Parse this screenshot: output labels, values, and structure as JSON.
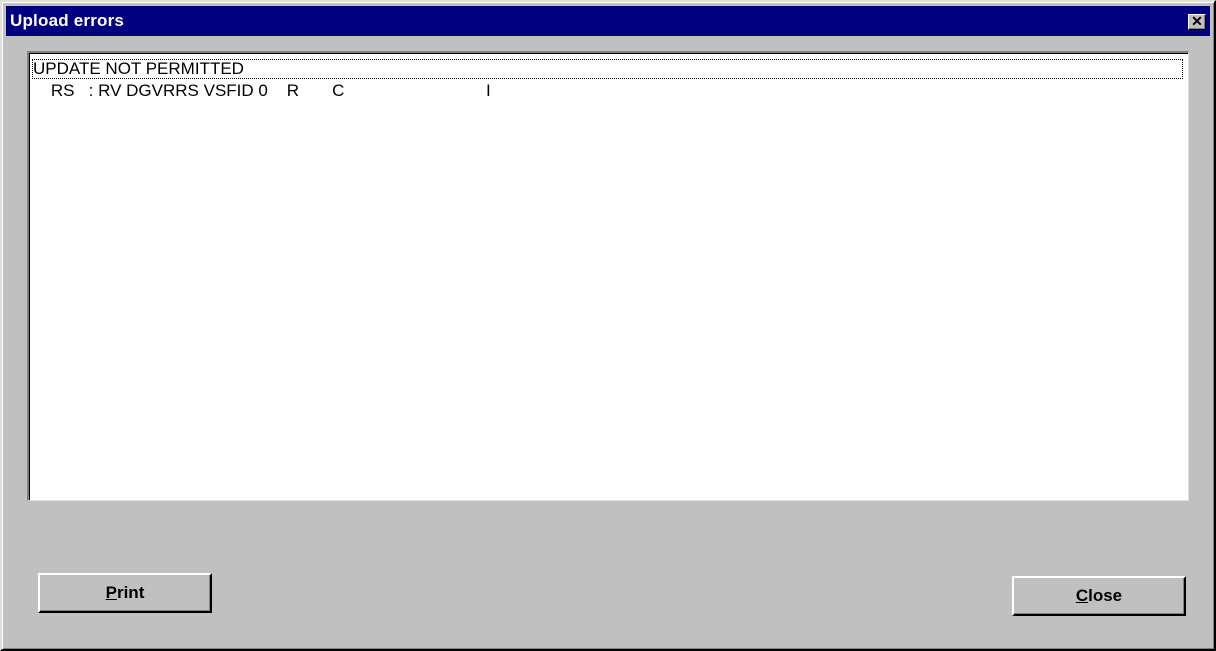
{
  "window": {
    "title": "Upload errors",
    "close_glyph": "✕"
  },
  "error_list": {
    "items": [
      "UPDATE NOT PERMITTED",
      "    RS   : RV DGVRRS VSFID 0    R       C                              I"
    ]
  },
  "buttons": {
    "print": {
      "mnemonic": "P",
      "rest": "rint"
    },
    "close": {
      "mnemonic": "C",
      "rest": "lose"
    }
  }
}
